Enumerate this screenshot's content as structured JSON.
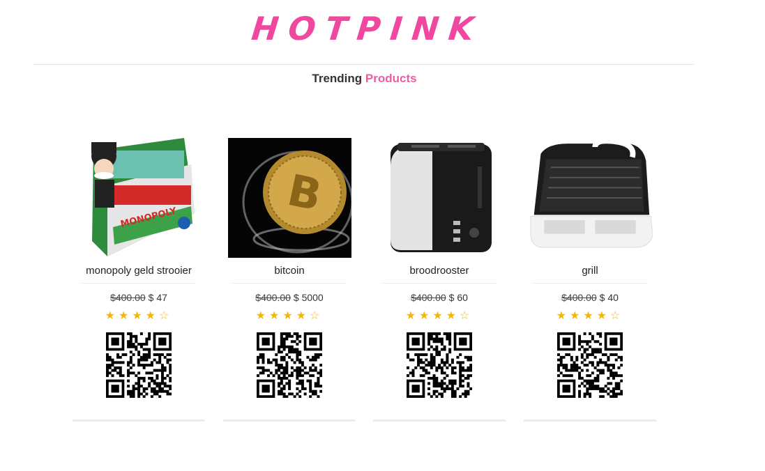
{
  "brand": {
    "logo_text": "HOTPINK"
  },
  "section": {
    "title_prefix": "Trending",
    "title_accent": "Products"
  },
  "colors": {
    "brand_pink": "#f0479f",
    "star_gold": "#f5b800"
  },
  "products": [
    {
      "name": "monopoly geld strooier",
      "old_price": "$400.00",
      "price": "$ 47",
      "rating": 4,
      "max_rating": 5,
      "image_icon": "monopoly-game-box-image",
      "qr_icon": "qr-code-icon"
    },
    {
      "name": "bitcoin",
      "old_price": "$400.00",
      "price": "$ 5000",
      "rating": 4,
      "max_rating": 5,
      "image_icon": "bitcoin-coin-image",
      "qr_icon": "qr-code-icon"
    },
    {
      "name": "broodrooster",
      "old_price": "$400.00",
      "price": "$ 60",
      "rating": 4,
      "max_rating": 5,
      "image_icon": "toaster-image",
      "qr_icon": "qr-code-icon"
    },
    {
      "name": "grill",
      "old_price": "$400.00",
      "price": "$ 40",
      "rating": 4,
      "max_rating": 5,
      "image_icon": "sandwich-grill-image",
      "qr_icon": "qr-code-icon"
    }
  ]
}
